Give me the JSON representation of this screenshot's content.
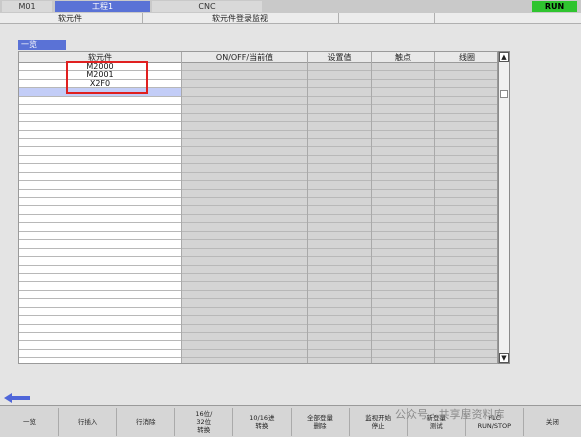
{
  "status_bar": {
    "machine": "M01",
    "process": "工程1",
    "mode": "CNC",
    "run_state": "RUN"
  },
  "title_bar": {
    "left": "软元件",
    "center": "软元件登录监视"
  },
  "list_tab": "一览",
  "table": {
    "headers": [
      "软元件",
      "ON/OFF/当前值",
      "设置值",
      "触点",
      "线圈"
    ],
    "devices": [
      "M2000",
      "M2001",
      "X2F0"
    ],
    "row_count": 35,
    "selected_row": 3
  },
  "function_keys": [
    "一览",
    "行插入",
    "行消除",
    "16位/\n32位\n转换",
    "10/16进\n转换",
    "全部登量\n删除",
    "监视开始\n停止",
    "新登量\n测试",
    "PLC\nRUN/STOP",
    "关闭"
  ],
  "watermark": "公众号 · 共享屋资料库",
  "icons": {
    "back": "left-arrow-icon",
    "up": "scroll-up-arrow-icon",
    "down": "scroll-down-arrow-icon"
  }
}
